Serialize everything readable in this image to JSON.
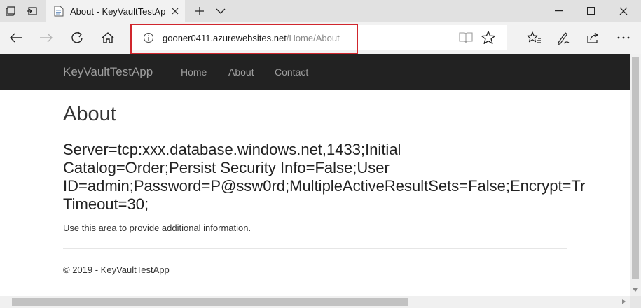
{
  "browser": {
    "tab_title": "About - KeyVaultTestAp",
    "url_host": "gooner0411.azurewebsites.net",
    "url_path": "/Home/About",
    "highlight_color": "#d0262d"
  },
  "site": {
    "brand": "KeyVaultTestApp",
    "nav": [
      "Home",
      "About",
      "Contact"
    ],
    "nav_bg_color": "#222222"
  },
  "page": {
    "title": "About",
    "connection_lines": [
      "Server=tcp:xxx.database.windows.net,1433;Initial",
      "Catalog=Order;Persist Security Info=False;User",
      "ID=admin;Password=P@ssw0rd;MultipleActiveResultSets=False;Encrypt=Tr",
      "Timeout=30;"
    ],
    "info": "Use this area to provide additional information.",
    "footer": "© 2019 - KeyVaultTestApp"
  },
  "icons": {
    "tab_strip": [
      "tab-manager-icon",
      "set-aside-tabs-icon",
      "page-favicon-icon",
      "close-tab-icon",
      "new-tab-icon",
      "tab-preview-chevron-icon"
    ],
    "window_controls": [
      "minimize-icon",
      "maximize-icon",
      "close-window-icon"
    ],
    "nav": [
      "back-icon",
      "forward-icon",
      "refresh-icon",
      "home-icon",
      "info-icon",
      "reading-view-icon",
      "favorite-star-icon",
      "favorites-hub-icon",
      "pen-notes-icon",
      "share-icon",
      "more-icon"
    ]
  }
}
